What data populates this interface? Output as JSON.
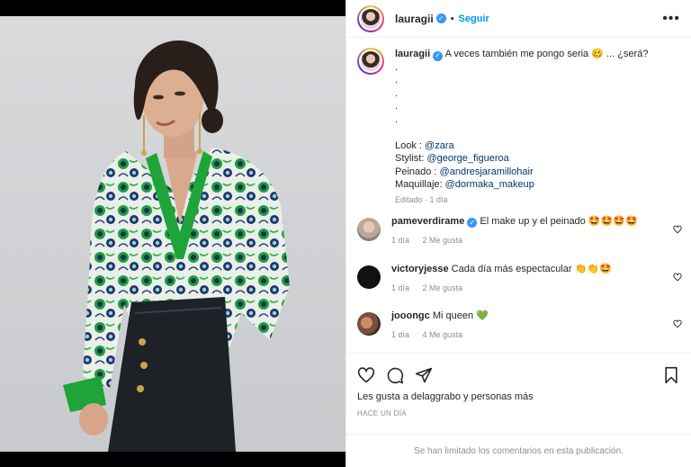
{
  "post": {
    "username": "lauragii",
    "follow_label": "Seguir",
    "more_label": "•••",
    "dot": "•"
  },
  "caption": {
    "username": "lauragii",
    "text": "A veces también me pongo seria 🥴 ... ¿será?",
    "dots": [
      ".",
      ".",
      ".",
      ".",
      "."
    ],
    "look_label": "Look : ",
    "look_mention": "@zara",
    "stylist_label": "Stylist: ",
    "stylist_mention": "@george_figueroa",
    "peinado_label": "Peinado : ",
    "peinado_mention": "@andresjaramillohair",
    "maquillaje_label": "Maquillaje: ",
    "maquillaje_mention": "@dormaka_makeup",
    "edited": "Editado · 1 día"
  },
  "comments": [
    {
      "username": "pameverdirame",
      "verified": true,
      "text": "El make up y el peinado 🤩🤩🤩🤩",
      "time": "1 día",
      "likes": "2 Me gusta"
    },
    {
      "username": "victoryjesse",
      "verified": false,
      "text": "Cada día más espectacular 👏👏🤩",
      "time": "1 día",
      "likes": "2 Me gusta"
    },
    {
      "username": "jooongc",
      "verified": false,
      "text": "Mi queen 💚",
      "time": "1 día",
      "likes": "4 Me gusta"
    }
  ],
  "footer": {
    "likes_text": "Les gusta a delaggrabo y personas más",
    "ago": "HACE UN DÍA",
    "limited": "Se han limitado los comentarios en esta publicación."
  },
  "icons": [
    "heart-icon",
    "comment-icon",
    "share-icon",
    "bookmark-icon",
    "verified-badge-icon",
    "more-options-icon"
  ],
  "colors": {
    "link": "#0095f6",
    "mention": "#00376b",
    "muted": "#8e8e8e",
    "verified": "#3897f0",
    "shirt_green": "#1fa43a"
  }
}
